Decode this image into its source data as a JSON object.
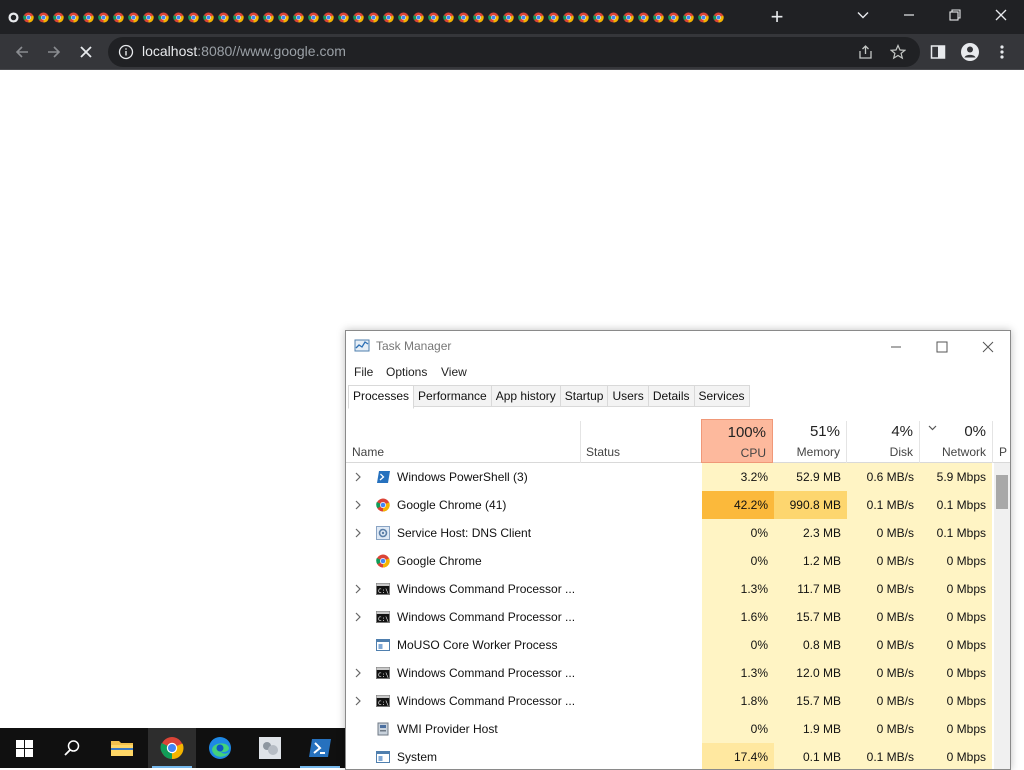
{
  "browser": {
    "tab_count": 48,
    "new_tab_glyph": "+",
    "url_host": "localhost",
    "url_rest": ":8080//www.google.com",
    "colors": {
      "titlebar": "#202124",
      "toolbar": "#35363a"
    }
  },
  "taskmanager": {
    "title": "Task Manager",
    "menu": [
      "File",
      "Options",
      "View"
    ],
    "tabs": [
      "Processes",
      "Performance",
      "App history",
      "Startup",
      "Users",
      "Details",
      "Services"
    ],
    "selected_tab": "Processes",
    "columns": {
      "name": "Name",
      "status": "Status",
      "cpu": {
        "pct": "100%",
        "label": "CPU"
      },
      "memory": {
        "pct": "51%",
        "label": "Memory"
      },
      "disk": {
        "pct": "4%",
        "label": "Disk"
      },
      "network": {
        "pct": "0%",
        "label": "Network"
      },
      "power_partial": "P"
    },
    "rows": [
      {
        "name": "Windows PowerShell (3)",
        "icon": "powershell-icon",
        "expand": true,
        "cpu": "3.2%",
        "memory": "52.9 MB",
        "disk": "0.6 MB/s",
        "network": "5.9 Mbps",
        "cpu_heat": "low",
        "mem_heat": "low"
      },
      {
        "name": "Google Chrome (41)",
        "icon": "chrome-icon",
        "expand": true,
        "cpu": "42.2%",
        "memory": "990.8 MB",
        "disk": "0.1 MB/s",
        "network": "0.1 Mbps",
        "cpu_heat": "high",
        "mem_heat": "high"
      },
      {
        "name": "Service Host: DNS Client",
        "icon": "service-gear-icon",
        "expand": true,
        "cpu": "0%",
        "memory": "2.3 MB",
        "disk": "0 MB/s",
        "network": "0.1 Mbps",
        "cpu_heat": "low",
        "mem_heat": "low"
      },
      {
        "name": "Google Chrome",
        "icon": "chrome-icon",
        "expand": false,
        "cpu": "0%",
        "memory": "1.2 MB",
        "disk": "0 MB/s",
        "network": "0 Mbps",
        "cpu_heat": "low",
        "mem_heat": "low"
      },
      {
        "name": "Windows Command Processor ...",
        "icon": "cmd-icon",
        "expand": true,
        "cpu": "1.3%",
        "memory": "11.7 MB",
        "disk": "0 MB/s",
        "network": "0 Mbps",
        "cpu_heat": "low",
        "mem_heat": "low"
      },
      {
        "name": "Windows Command Processor ...",
        "icon": "cmd-icon",
        "expand": true,
        "cpu": "1.6%",
        "memory": "15.7 MB",
        "disk": "0 MB/s",
        "network": "0 Mbps",
        "cpu_heat": "low",
        "mem_heat": "low"
      },
      {
        "name": "MoUSO Core Worker Process",
        "icon": "app-window-icon",
        "expand": false,
        "cpu": "0%",
        "memory": "0.8 MB",
        "disk": "0 MB/s",
        "network": "0 Mbps",
        "cpu_heat": "low",
        "mem_heat": "low"
      },
      {
        "name": "Windows Command Processor ...",
        "icon": "cmd-icon",
        "expand": true,
        "cpu": "1.3%",
        "memory": "12.0 MB",
        "disk": "0 MB/s",
        "network": "0 Mbps",
        "cpu_heat": "low",
        "mem_heat": "low"
      },
      {
        "name": "Windows Command Processor ...",
        "icon": "cmd-icon",
        "expand": true,
        "cpu": "1.8%",
        "memory": "15.7 MB",
        "disk": "0 MB/s",
        "network": "0 Mbps",
        "cpu_heat": "low",
        "mem_heat": "low"
      },
      {
        "name": "WMI Provider Host",
        "icon": "wmi-icon",
        "expand": false,
        "cpu": "0%",
        "memory": "1.9 MB",
        "disk": "0 MB/s",
        "network": "0 Mbps",
        "cpu_heat": "low",
        "mem_heat": "low"
      },
      {
        "name": "System",
        "icon": "app-window-icon",
        "expand": false,
        "cpu": "17.4%",
        "memory": "0.1 MB",
        "disk": "0.1 MB/s",
        "network": "0 Mbps",
        "cpu_heat": "mid",
        "mem_heat": "low"
      }
    ],
    "heat_colors": {
      "header_cpu": "#fdb99d",
      "low": "#fff4c4",
      "mid": "#ffe8a0",
      "high": "#fbb93b",
      "mem_high": "#fdd66f"
    }
  },
  "taskbar": {
    "items": [
      "start-icon",
      "search-icon",
      "file-explorer-icon",
      "chrome-icon",
      "edge-icon",
      "app-icon",
      "powershell-icon"
    ],
    "active": "chrome-icon"
  }
}
